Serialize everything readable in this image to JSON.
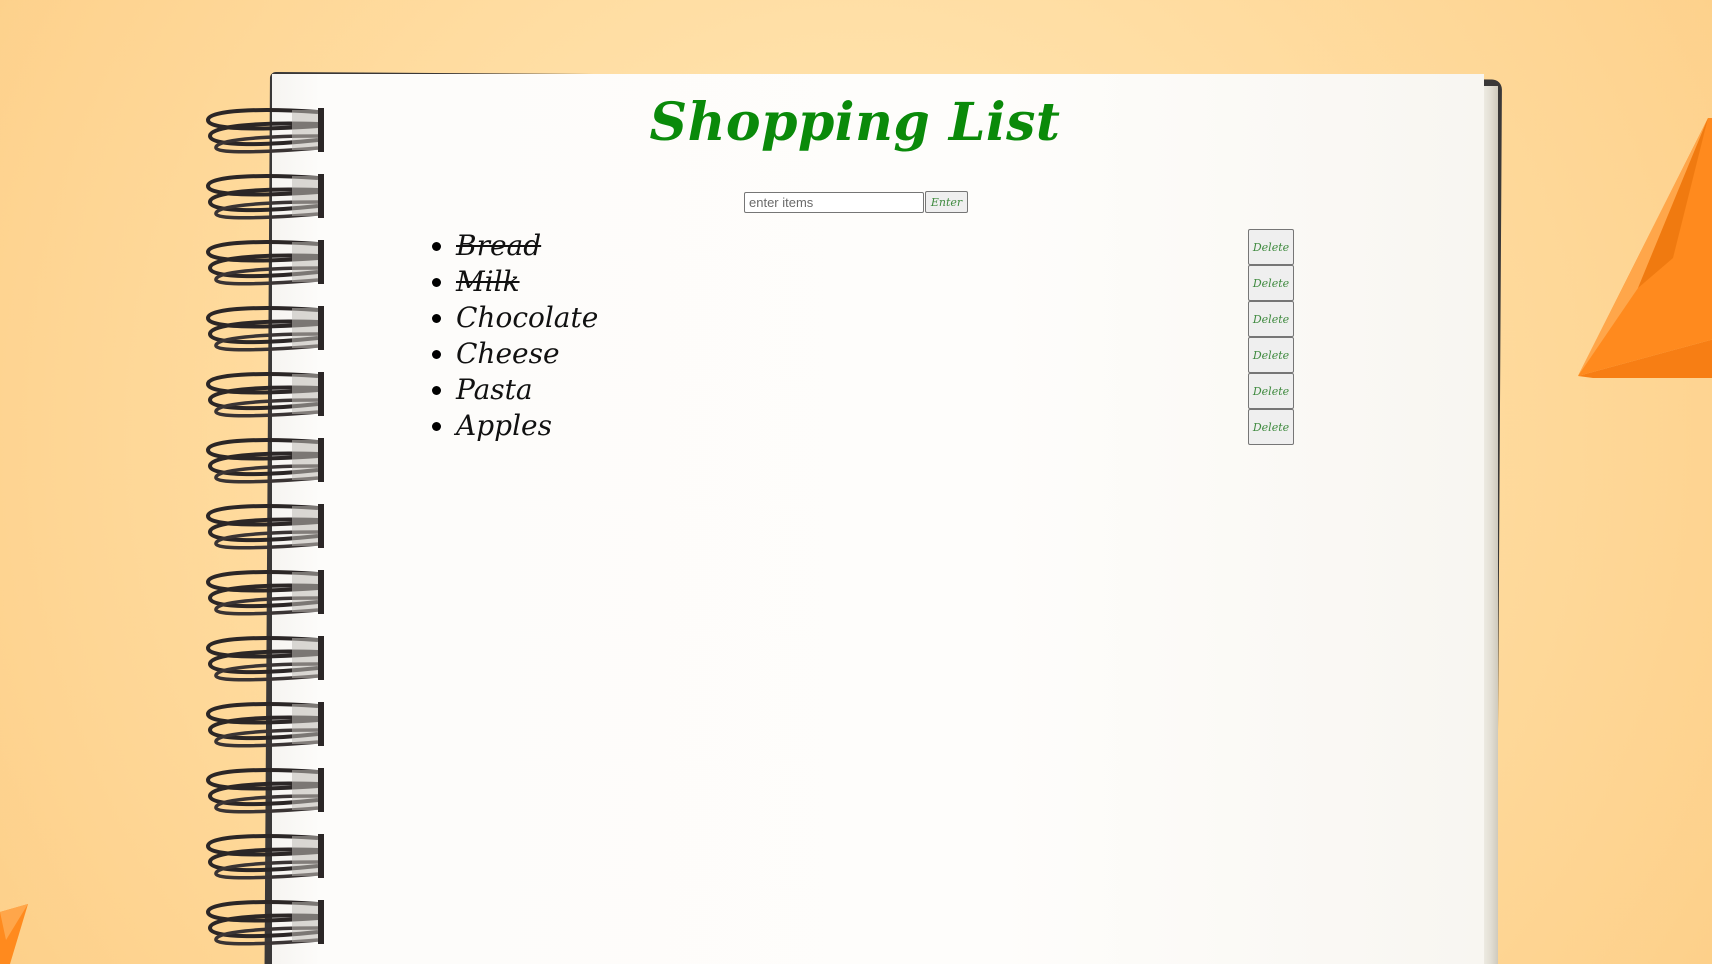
{
  "app": {
    "title": "Shopping List"
  },
  "entry": {
    "placeholder": "enter items",
    "value": "",
    "button_label": "Enter"
  },
  "items": [
    {
      "label": "Bread",
      "done": true,
      "delete_label": "Delete"
    },
    {
      "label": "Milk",
      "done": true,
      "delete_label": "Delete"
    },
    {
      "label": "Chocolate",
      "done": false,
      "delete_label": "Delete"
    },
    {
      "label": "Cheese",
      "done": false,
      "delete_label": "Delete"
    },
    {
      "label": "Pasta",
      "done": false,
      "delete_label": "Delete"
    },
    {
      "label": "Apples",
      "done": false,
      "delete_label": "Delete"
    }
  ],
  "colors": {
    "title": "#0a8a0a",
    "button_text": "#3f8a3f",
    "background": "#ffdca0",
    "paper": "#fefdfb",
    "plane": "#ff8a1e"
  },
  "icons": {
    "spiral": "spiral-binding-icon",
    "plane": "paper-plane-icon",
    "bullet": "bullet-icon"
  }
}
